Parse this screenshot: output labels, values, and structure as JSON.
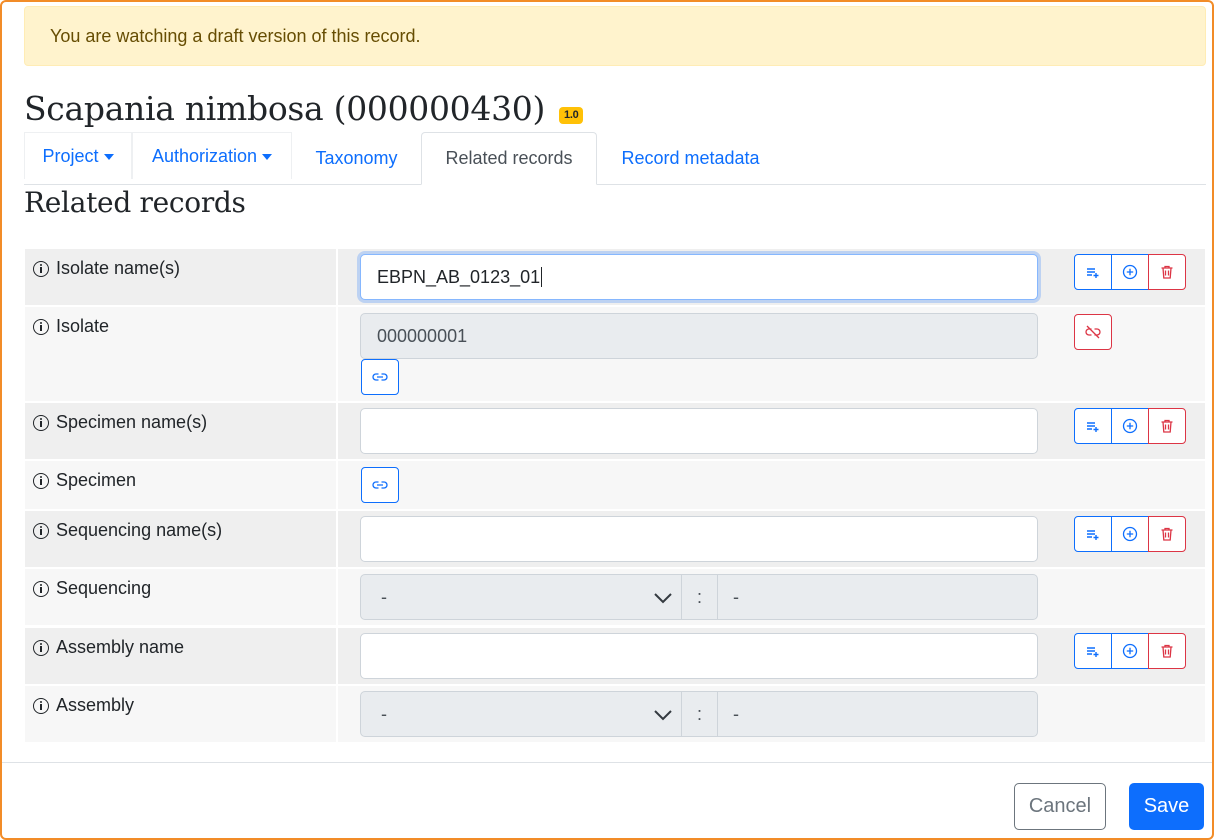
{
  "alert": {
    "text": "You are watching a draft version of this record."
  },
  "record": {
    "title": "Scapania nimbosa (000000430)",
    "version": "1.0"
  },
  "tabs": [
    {
      "label": "Project"
    },
    {
      "label": "Authorization"
    },
    {
      "label": "Taxonomy"
    },
    {
      "label": "Related records"
    },
    {
      "label": "Record metadata"
    }
  ],
  "section": {
    "title": "Related records"
  },
  "fields": {
    "isolate_names": {
      "label": "Isolate name(s)",
      "value": "EBPN_AB_0123_01"
    },
    "isolate": {
      "label": "Isolate",
      "value": "000000001"
    },
    "specimen_names": {
      "label": "Specimen name(s)",
      "value": ""
    },
    "specimen": {
      "label": "Specimen"
    },
    "sequencing_names": {
      "label": "Sequencing name(s)",
      "value": ""
    },
    "sequencing": {
      "label": "Sequencing",
      "major": "-",
      "separator": ":",
      "minor": "-"
    },
    "assembly_name": {
      "label": "Assembly name",
      "value": ""
    },
    "assembly": {
      "label": "Assembly",
      "major": "-",
      "separator": ":",
      "minor": "-"
    }
  },
  "footer": {
    "cancel": "Cancel",
    "save": "Save"
  },
  "colors": {
    "primary": "#0d6efd",
    "danger": "#dc3545",
    "warning_bg": "#fff3cd",
    "badge": "#ffc107"
  }
}
